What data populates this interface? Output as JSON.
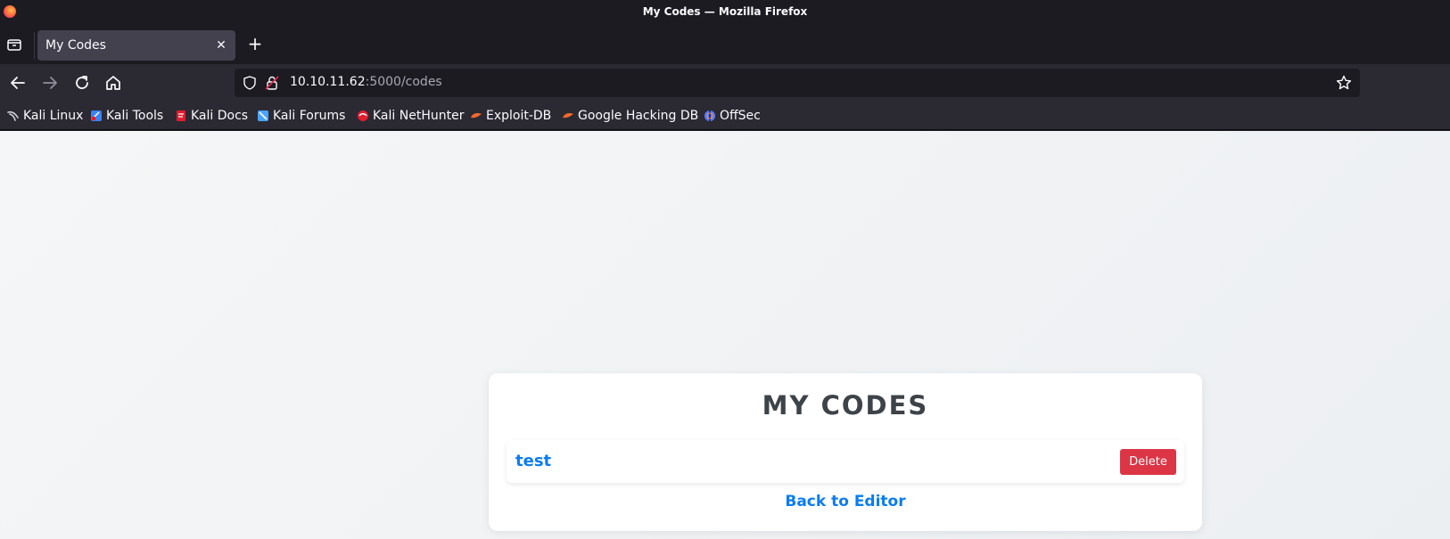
{
  "window": {
    "title": "My Codes — Mozilla Firefox"
  },
  "tabs": [
    {
      "label": "My Codes",
      "close": "✕"
    }
  ],
  "new_tab": "+",
  "urlbar": {
    "host": "10.10.11.62",
    "path": ":5000/codes"
  },
  "bookmarks": [
    {
      "label": "Kali Linux",
      "icon": "kali-dragon-icon",
      "color": "#cfd3d8"
    },
    {
      "label": "Kali Tools",
      "icon": "kali-tools-icon",
      "color": "#3b82f6"
    },
    {
      "label": "Kali Docs",
      "icon": "kali-docs-icon",
      "color": "#e11d2e"
    },
    {
      "label": "Kali Forums",
      "icon": "kali-forums-icon",
      "color": "#4aa3ff"
    },
    {
      "label": "Kali NetHunter",
      "icon": "kali-nethunter-icon",
      "color": "#e11d2e"
    },
    {
      "label": "Exploit-DB",
      "icon": "exploit-db-icon",
      "color": "#f2682c"
    },
    {
      "label": "Google Hacking DB",
      "icon": "ghdb-icon",
      "color": "#f2682c"
    },
    {
      "label": "OffSec",
      "icon": "offsec-icon",
      "color": "#5b7cff"
    }
  ],
  "page": {
    "title": "MY CODES",
    "codes": [
      {
        "name": "test",
        "delete_label": "Delete"
      }
    ],
    "back_link": "Back to Editor"
  },
  "colors": {
    "link": "#0a7cf0",
    "danger": "#dc3545",
    "heading": "#3d4349"
  }
}
